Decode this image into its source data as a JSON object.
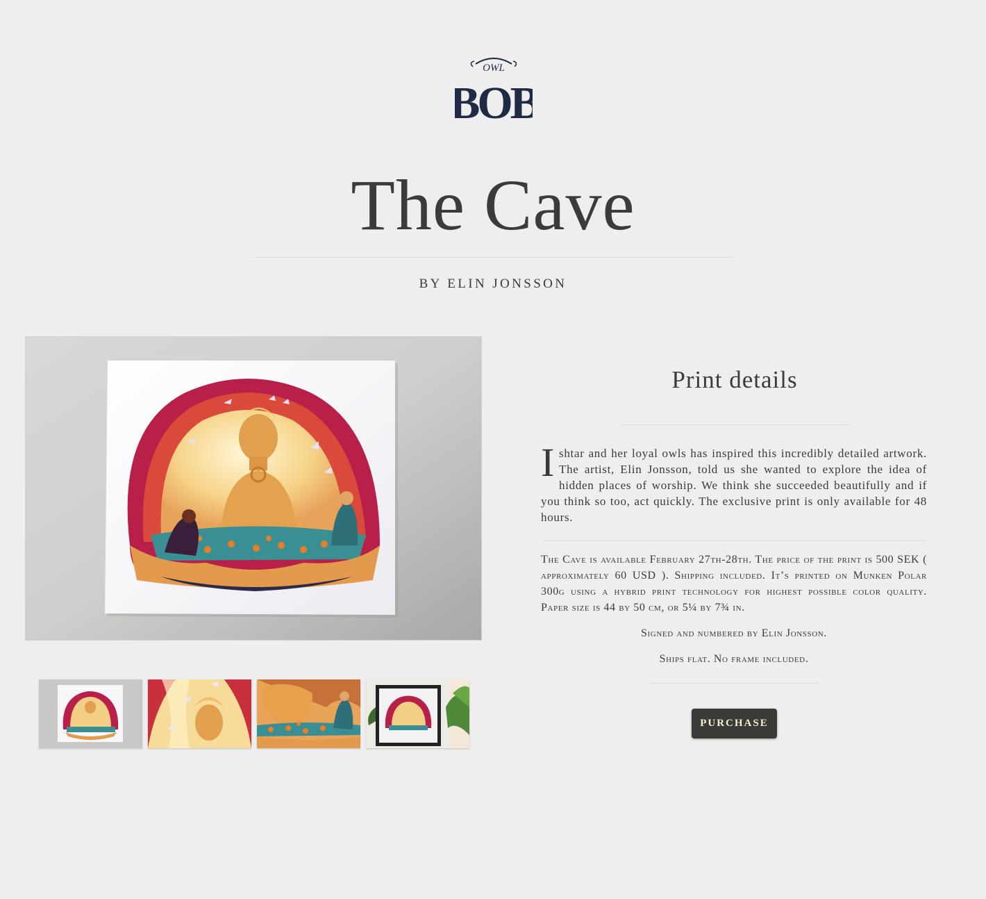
{
  "brand": {
    "logo_text_top": "OWL",
    "logo_text_main": "BOB"
  },
  "product": {
    "title": "The Cave",
    "byline": "by Elin Jonsson"
  },
  "details": {
    "heading": "Print details",
    "intro_dropcap": "I",
    "intro_text": "shtar and her loyal owls has inspired this incredibly detailed artwork. The artist, Elin Jonsson, told us she wanted to explore the idea of hidden places of worship. We think she succeeded beautifully and if you think so too, act quickly. The exclusive print is only available for 48 hours.",
    "specs_text": "The Cave is available February 27th-28th. The price of the print is 500 SEK ( approximately 60 USD ). Shipping included. It’s printed on Munken Polar 300g using a hybrid print technology for highest possible color quality. Paper size is 44 by 50 cm, or 5¼ by 7¾ in.",
    "signed_text": "Signed and numbered by Elin Jonsson.",
    "ships_text": "Ships flat. No frame included."
  },
  "actions": {
    "purchase_label": "Purchase"
  },
  "gallery": {
    "thumbnails": [
      "full-print",
      "detail-top",
      "detail-bottom",
      "framed"
    ]
  },
  "colors": {
    "background": "#eeeeee",
    "text": "#3a3a3a",
    "button_bg": "#3a3a36",
    "button_text": "#f6efd0",
    "logo": "#1f2a44"
  }
}
